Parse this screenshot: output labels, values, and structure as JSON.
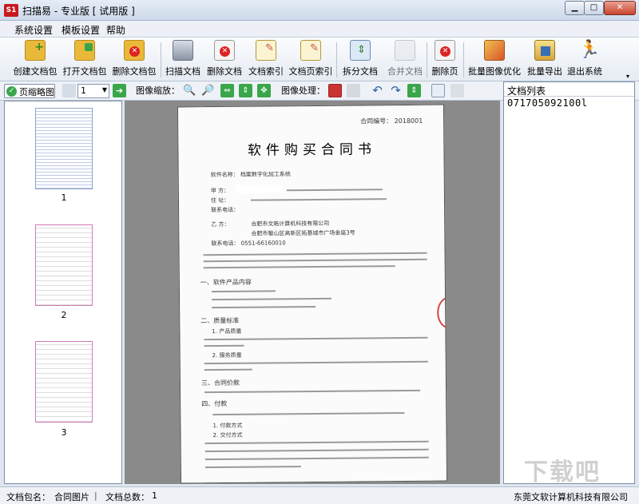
{
  "window": {
    "title": "扫描易 - 专业版 [ 试用版 ]",
    "logo": "S1"
  },
  "menubar": {
    "items": [
      "系统设置",
      "模板设置",
      "帮助"
    ]
  },
  "toolbar": {
    "buttons": [
      {
        "label": "创建文档包",
        "icon": "folder-add-icon"
      },
      {
        "label": "打开文档包",
        "icon": "folder-open-icon"
      },
      {
        "label": "删除文档包",
        "icon": "folder-delete-icon"
      },
      {
        "label": "扫描文档",
        "icon": "scanner-icon"
      },
      {
        "label": "删除文档",
        "icon": "document-delete-icon"
      },
      {
        "label": "文档索引",
        "icon": "document-index-icon"
      },
      {
        "label": "文档页索引",
        "icon": "page-index-icon"
      },
      {
        "label": "拆分文档",
        "icon": "split-icon"
      },
      {
        "label": "合并文档",
        "icon": "merge-icon"
      },
      {
        "label": "删除页",
        "icon": "page-delete-icon"
      },
      {
        "label": "批量图像优化",
        "icon": "image-optimize-icon"
      },
      {
        "label": "批量导出",
        "icon": "export-icon"
      },
      {
        "label": "退出系统",
        "icon": "exit-icon"
      }
    ]
  },
  "toolbar2": {
    "thumb_tab": "页缩略图",
    "page_value": "1",
    "zoom_label": "图像缩放：",
    "process_label": "图像处理："
  },
  "thumbnails": [
    "1",
    "2",
    "3"
  ],
  "document": {
    "contract_no": "合同编号： 2018001",
    "title": "软件购买合同书",
    "software_name": "软件名称：  档案数字化加工系统",
    "party_a_label": "甲    方：",
    "party_a_address": "住    址：",
    "party_a_contact": "联系电话：",
    "party_b_label": "乙    方：",
    "party_b_name": "合肥市文皓计算机科技有限公司",
    "party_b_address": "合肥市蜀山区高新区拓基城市广场金座3号",
    "party_b_phone": "联系电话：   0551-66160010",
    "sections": [
      "一、软件产品内容",
      "二、质量标准",
      "1. 产品质量",
      "2. 服务质量",
      "三、合同价款",
      "四、付款",
      "1. 付款方式",
      "2. 交付方式"
    ]
  },
  "right_panel": {
    "header": "文档列表",
    "items": [
      "071705092100l"
    ]
  },
  "statusbar": {
    "package_label": "文档包名：",
    "package_value": "合同图片",
    "count_label": "文档总数：",
    "count_value": "1",
    "company": "东莞文软计算机科技有限公司"
  },
  "watermark": "下载吧"
}
